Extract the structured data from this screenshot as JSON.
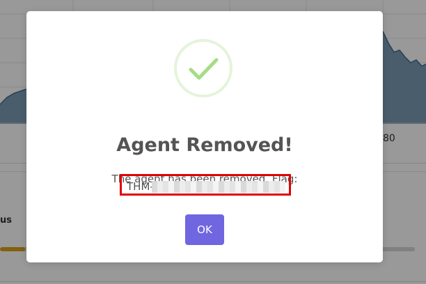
{
  "background": {
    "x_tick_label": "80",
    "status_label": "us",
    "progress_fraction": 0.06,
    "colors": {
      "chart_fill": "#7a9bb4",
      "chart_line": "#3f6c8e",
      "progress_fill": "#d9a01a"
    }
  },
  "dialog": {
    "icon": "success-checkmark-icon",
    "title": "Agent Removed!",
    "message": "The agent has been removed. Flag:",
    "flag": "THM-",
    "flag_redacted": true,
    "confirm_label": "OK",
    "colors": {
      "confirm_button": "#7066e0",
      "checkmark": "#a5dc86",
      "highlight_border": "#e00000"
    }
  }
}
